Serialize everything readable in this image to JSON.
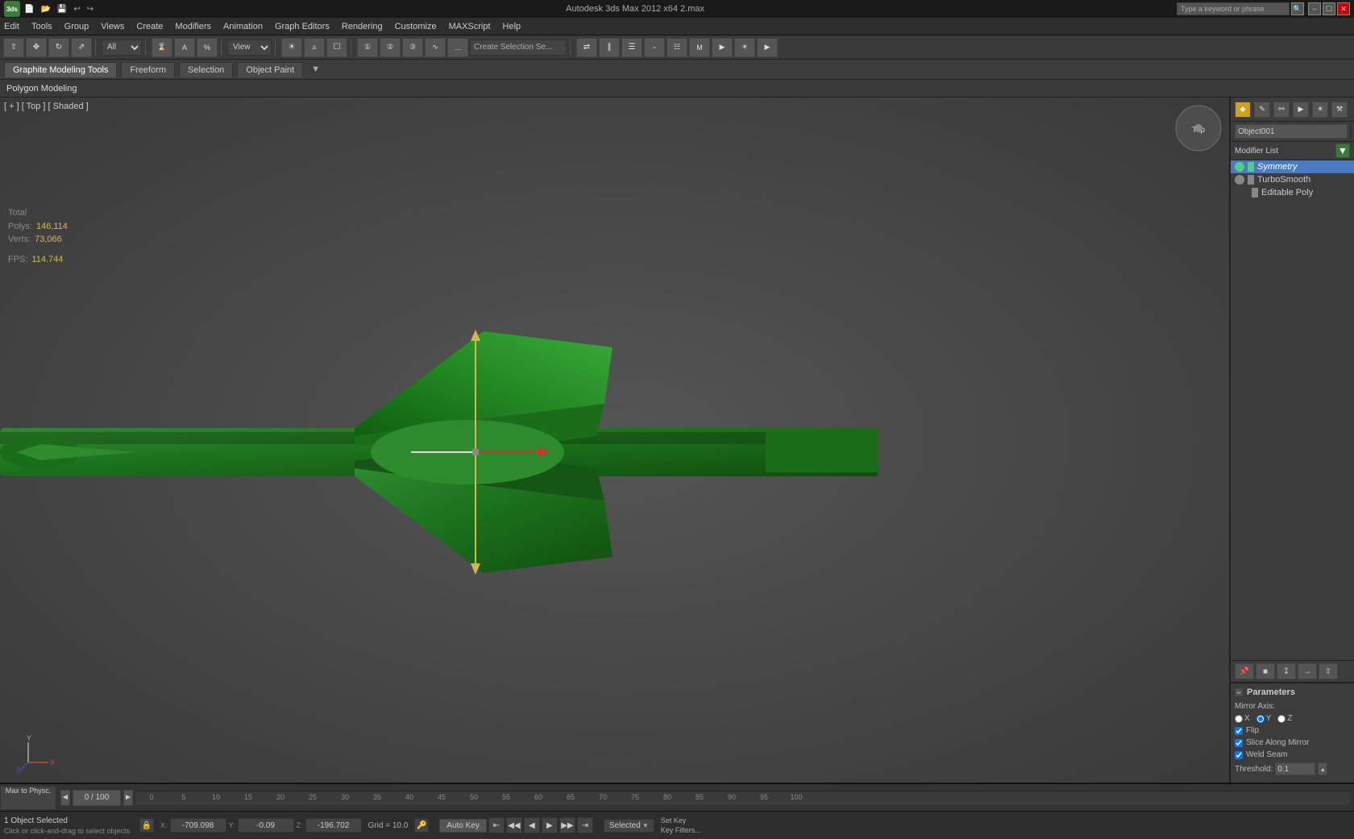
{
  "app": {
    "title": "Autodesk 3ds Max 2012 x64    2.max",
    "logo": "3ds"
  },
  "menubar": {
    "items": [
      "Edit",
      "Tools",
      "Group",
      "Views",
      "Create",
      "Modifiers",
      "Animation",
      "Graph Editors",
      "Rendering",
      "Customize",
      "MAXScript",
      "Help"
    ]
  },
  "ribbon": {
    "tabs": [
      {
        "label": "Graphite Modeling Tools",
        "active": true
      },
      {
        "label": "Freeform",
        "active": false
      },
      {
        "label": "Selection",
        "active": false
      },
      {
        "label": "Object Paint",
        "active": false
      }
    ]
  },
  "viewport": {
    "label": "[ + ] [ Top ] [ Shaded ]",
    "stats": {
      "total_label": "Total",
      "polys_label": "Polys:",
      "polys_value": "146,114",
      "verts_label": "Verts:",
      "verts_value": "73,066",
      "fps_label": "FPS:",
      "fps_value": "114.744"
    }
  },
  "right_panel": {
    "object_name": "Object001",
    "modifier_list_label": "Modifier List",
    "modifiers": [
      {
        "name": "Symmetry",
        "selected": true,
        "color": "green",
        "eye": true
      },
      {
        "name": "TurboSmooth",
        "selected": false,
        "color": "gray",
        "eye": true
      },
      {
        "name": "Editable Poly",
        "selected": false,
        "color": "gray",
        "eye": false
      }
    ],
    "parameters": {
      "title": "Parameters",
      "mirror_axis_label": "Mirror Axis:",
      "axis_options": [
        "X",
        "Y",
        "Z"
      ],
      "selected_axis": "Y",
      "flip_label": "Flip",
      "flip_checked": true,
      "slice_along_mirror_label": "Slice Along Mirror",
      "slice_along_mirror_checked": true,
      "weld_seam_label": "Weld Seam",
      "weld_seam_checked": true,
      "threshold_label": "Threshold:",
      "threshold_value": "0.1"
    }
  },
  "timeline": {
    "frame": "0 / 100",
    "markers": [
      "0",
      "5",
      "10",
      "15",
      "20",
      "25",
      "30",
      "35",
      "40",
      "45",
      "50",
      "55",
      "60",
      "65",
      "70",
      "75",
      "80",
      "85",
      "90",
      "95",
      "100"
    ]
  },
  "status_bar": {
    "selected_text": "1 Object Selected",
    "hint_text": "Click or click-and-drag to select objects",
    "coords": {
      "x_label": "X:",
      "x_value": "-709.098",
      "y_label": "Y:",
      "y_value": "-0.09",
      "z_label": "Z:",
      "z_value": "-196.702"
    },
    "grid": "Grid = 10.0",
    "autokey": "Auto Key",
    "selected_label": "Selected",
    "set_key": "Set Key",
    "key_filters": "Key Filters..."
  },
  "playback": {
    "buttons": [
      "|◀",
      "◀◀",
      "◀",
      "▶",
      "▶▶",
      "▶|",
      "▶▶|"
    ]
  }
}
